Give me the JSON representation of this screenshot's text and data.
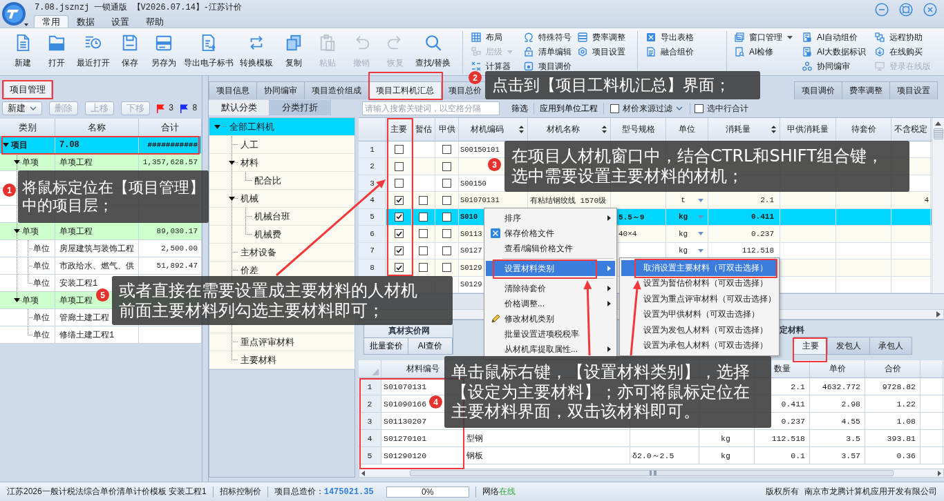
{
  "window": {
    "title": "7.08.jsznzj 一锁通版 【V2026.07.14】-江苏计价"
  },
  "menu_tabs": [
    {
      "label": "常用",
      "selected": true
    },
    {
      "label": "数据",
      "selected": false
    },
    {
      "label": "设置",
      "selected": false
    },
    {
      "label": "帮助",
      "selected": false
    }
  ],
  "ribbon": {
    "large_buttons": [
      {
        "label": "新建",
        "disabled": false
      },
      {
        "label": "打开",
        "disabled": false
      },
      {
        "label": "最近打开",
        "disabled": false
      },
      {
        "label": "保存",
        "disabled": false
      },
      {
        "label": "另存为",
        "disabled": false
      },
      {
        "label": "导出电子标书",
        "disabled": false
      },
      {
        "label": "转换模板",
        "disabled": false
      },
      {
        "label": "复制",
        "disabled": false
      },
      {
        "label": "粘贴",
        "disabled": true
      },
      {
        "label": "撤销",
        "disabled": true
      },
      {
        "label": "恢复",
        "disabled": true
      },
      {
        "label": "查找/替换",
        "disabled": false
      }
    ],
    "groups": [
      {
        "columns": [
          [
            {
              "label": "布局",
              "disabled": false
            },
            {
              "label": "层级",
              "disabled": true,
              "dropdown": true
            },
            {
              "label": "计算器",
              "disabled": false
            }
          ],
          [
            {
              "label": "特殊符号",
              "disabled": false
            },
            {
              "label": "清单编辑",
              "disabled": false
            },
            {
              "label": "项目调价",
              "disabled": false
            }
          ],
          [
            {
              "label": "费率调整",
              "disabled": false
            },
            {
              "label": "项目设置",
              "disabled": false
            }
          ]
        ]
      },
      {
        "columns": [
          [
            {
              "label": "导出表格",
              "disabled": false
            },
            {
              "label": "融合组价",
              "disabled": false
            }
          ]
        ]
      },
      {
        "columns": [
          [
            {
              "label": "窗口管理",
              "disabled": false,
              "dropdown": true
            },
            {
              "label": "AI检修",
              "disabled": false
            }
          ],
          [
            {
              "label": "AI自动组价",
              "disabled": false
            },
            {
              "label": "AI大数据标识",
              "disabled": false
            },
            {
              "label": "协同编审",
              "disabled": false
            }
          ],
          [
            {
              "label": "远程协助",
              "disabled": false
            },
            {
              "label": "在线购买",
              "disabled": false
            },
            {
              "label": "登录在线版",
              "disabled": true
            }
          ]
        ]
      }
    ]
  },
  "project_panel": {
    "tab": {
      "label": "项目管理",
      "selected": true
    },
    "toolbar": [
      {
        "label": "新建",
        "disabled": false,
        "dropdown": true
      },
      {
        "label": "删除",
        "disabled": true
      },
      {
        "label": "上移",
        "disabled": true
      },
      {
        "label": "下移",
        "disabled": true
      }
    ],
    "flags": [
      {
        "color": "#ff1a1a",
        "count": "3"
      },
      {
        "color": "#1a2cff",
        "count": "8"
      }
    ],
    "columns": [
      "类别",
      "名称",
      "合计"
    ],
    "tree": [
      {
        "kind": "project",
        "category": "项目",
        "name": "7.08",
        "total": "###########",
        "selected": true,
        "expanded": true,
        "children": [
          {
            "kind": "section",
            "category": "单项",
            "name": "单项工程",
            "total": "1,357,628.57",
            "selected": false,
            "expanded": true,
            "children": [
              {
                "kind": "unit",
                "selected": false
              },
              {
                "kind": "unit",
                "selected": false
              },
              {
                "kind": "unit",
                "selected": false
              }
            ]
          },
          {
            "kind": "section",
            "category": "单项",
            "name": "单项工程",
            "total": "89,030.17",
            "selected": false,
            "expanded": true,
            "children": [
              {
                "kind": "unit",
                "category": "单位",
                "name": "房屋建筑与装饰工程",
                "total": "2,500.00",
                "selected": false
              },
              {
                "kind": "unit",
                "category": "单位",
                "name": "市政给水、燃气、供",
                "total": "51,892.47",
                "selected": false
              },
              {
                "kind": "unit",
                "category": "单位",
                "name": "安装工程1",
                "selected": false
              }
            ]
          },
          {
            "kind": "section",
            "category": "单项",
            "name": "单项工程",
            "selected": false,
            "expanded": true,
            "children": [
              {
                "kind": "unit",
                "category": "单位",
                "name": "管廊土建工程",
                "selected": false
              },
              {
                "kind": "unit",
                "category": "单位",
                "name": "修缮土建工程1",
                "selected": false
              }
            ]
          }
        ]
      }
    ]
  },
  "main_tabs": [
    {
      "label": "项目信息",
      "selected": false
    },
    {
      "label": "协同编审",
      "selected": false
    },
    {
      "label": "项目造价组成",
      "selected": false
    },
    {
      "label": "项目工料机汇总",
      "selected": true
    },
    {
      "label": "项目总价",
      "selected": false
    }
  ],
  "main_actions": [
    "项目调价",
    "费率调整",
    "项目设置"
  ],
  "category_panel": {
    "tabs": [
      {
        "label": "默认分类",
        "selected": true
      },
      {
        "label": "分类打折",
        "selected": false
      }
    ],
    "tree": [
      {
        "label": "全部工料机",
        "selected": true,
        "expanded": true,
        "children": [
          {
            "label": "人工",
            "selected": false
          },
          {
            "label": "材料",
            "selected": false,
            "expanded": true,
            "children": [
              {
                "label": "配合比",
                "selected": false
              }
            ]
          },
          {
            "label": "机械",
            "selected": false,
            "expanded": true,
            "children": [
              {
                "label": "机械台班",
                "selected": false
              },
              {
                "label": "机械费",
                "selected": false
              }
            ]
          },
          {
            "label": "主材设备",
            "selected": false
          },
          {
            "label": "价差",
            "selected": false
          },
          {
            "selected": false
          },
          {
            "selected": false
          },
          {
            "selected": false
          },
          {
            "label": "重点评审材料",
            "selected": false
          },
          {
            "label": "主要材料",
            "selected": false
          }
        ]
      }
    ]
  },
  "materials_grid": {
    "search": {
      "placeholder": "请输入搜索关键词，以空格分隔"
    },
    "buttons": [
      "筛选",
      "应用到单位工程"
    ],
    "options": [
      {
        "label": "材价来源过滤",
        "checked": false,
        "dropdown": true
      },
      {
        "label": "选中行合计",
        "checked": false
      }
    ],
    "columns": [
      {
        "label": "主要"
      },
      {
        "label": "暂估"
      },
      {
        "label": "甲供"
      },
      {
        "label": "材机编码",
        "sortable": true
      },
      {
        "label": "材机名称",
        "sortable": true
      },
      {
        "label": "型号规格"
      },
      {
        "label": "单位"
      },
      {
        "label": "消耗量",
        "sortable": true
      },
      {
        "label": "甲供消耗量"
      },
      {
        "label": "待套价"
      },
      {
        "label": "不含税定"
      }
    ],
    "rows": [
      {
        "number": "1",
        "main": false,
        "owner_supplied": false,
        "code": "S00150101",
        "selected": false
      },
      {
        "number": "2",
        "main": false,
        "owner_supplied": false,
        "selected": false
      },
      {
        "number": "3",
        "main": false,
        "owner_supplied": false,
        "code": "S00150",
        "selected": false
      },
      {
        "number": "4",
        "main": true,
        "provisional": false,
        "owner_supplied": false,
        "code": "S01070131",
        "name": "有粘结钢绞线 1570级",
        "unit": "t",
        "quantity": "2.1",
        "excl_tax": "4",
        "selected": false
      },
      {
        "number": "5",
        "main": true,
        "provisional": false,
        "owner_supplied": false,
        "code": "S010",
        "spec": "5.5～9",
        "unit": "kg",
        "quantity": "0.411",
        "selected": true
      },
      {
        "number": "6",
        "main": true,
        "provisional": false,
        "owner_supplied": false,
        "code": "S0113",
        "spec": "40×4",
        "unit": "kg",
        "quantity": "0.237",
        "selected": false
      },
      {
        "number": "7",
        "main": true,
        "provisional": false,
        "owner_supplied": false,
        "code": "S0127",
        "unit": "kg",
        "quantity": "112.518",
        "selected": false
      },
      {
        "number": "8",
        "main": true,
        "provisional": false,
        "owner_supplied": false,
        "code": "S0129",
        "selected": false
      },
      {
        "code": "S0129",
        "selected": false
      }
    ]
  },
  "bottom_panel": {
    "left_group": {
      "title": "真材实价网",
      "buttons": [
        "批量套价",
        "AI查价"
      ]
    },
    "right_group": {
      "title": "定材料",
      "tabs": [
        {
          "label": "主要",
          "selected": true
        },
        {
          "label": "发包人",
          "selected": false
        },
        {
          "label": "承包人",
          "selected": false
        }
      ]
    },
    "columns": [
      "材料编号",
      null,
      null,
      null,
      "数量",
      "单价",
      "合价"
    ],
    "rows": [
      {
        "number": "1",
        "code": "S01070131",
        "quantity": "2.1",
        "price": "4632.772",
        "amount": "9728.82"
      },
      {
        "number": "2",
        "code": "S01090166",
        "quantity": "0.411",
        "price": "2.98",
        "amount": "1.22"
      },
      {
        "number": "3",
        "code": "S01130207",
        "quantity": "0.237",
        "price": "4.55",
        "amount": "1.08"
      },
      {
        "number": "4",
        "code": "S01270101",
        "name": "型钢",
        "unit": "kg",
        "quantity": "112.518",
        "price": "3.5",
        "amount": "393.81"
      },
      {
        "number": "5",
        "code": "S01290120",
        "name": "钢板",
        "spec": "δ2.0～2.5",
        "unit": "kg",
        "quantity": "0.1",
        "price": "3.57",
        "amount": "0.36"
      }
    ]
  },
  "context_menu": [
    {
      "label": "排序",
      "submenu": true,
      "selected": false
    },
    {
      "label": "保存价格文件",
      "selected": false
    },
    {
      "label": "查看/编辑价格文件",
      "selected": false
    },
    {
      "label": "设置材料类别",
      "submenu": true,
      "divider_before": true,
      "selected": true
    },
    {
      "label": "清除待套价",
      "submenu": true,
      "divider_before": true,
      "selected": false
    },
    {
      "label": "价格调整...",
      "submenu": true,
      "selected": false
    },
    {
      "label": "修改材机类别",
      "selected": false
    },
    {
      "label": "批量设置进项税税率",
      "selected": false
    },
    {
      "label": "从材机库提取属性...",
      "submenu": true,
      "selected": false
    }
  ],
  "submenu": [
    {
      "label": "取消设置主要材料（可双击选择）",
      "selected": true
    },
    {
      "label": "设置为暂估价材料（可双击选择）",
      "selected": false
    },
    {
      "label": "设置为重点评审材料（可双击选择）",
      "selected": false
    },
    {
      "label": "设置为甲供材料（可双击选择）",
      "selected": false
    },
    {
      "label": "设置为发包人材料（可双击选择）",
      "selected": false
    },
    {
      "label": "设置为承包人材料（可双击选择）",
      "selected": false
    }
  ],
  "annotations": [
    {
      "number": "1",
      "text": "将鼠标定位在【项目管理】中的项目层；"
    },
    {
      "number": "2",
      "text": "点击到【项目工料机汇总】界面；"
    },
    {
      "number": "3",
      "text": "在项目人材机窗口中，结合CTRL和SHIFT组合键，选中需要设置主要材料的材机；"
    },
    {
      "number": "4",
      "text": "单击鼠标右键，【设置材料类别】，选择【设定为主要材料】；亦可将鼠标定位在主要材料界面，双击该材料即可。"
    },
    {
      "number": "5",
      "text": "或者直接在需要设置成主要材料的人材机前面主要材料列勾选主要材料即可；"
    }
  ],
  "status_bar": {
    "template": "江苏2026一般计税法综合单价清单计价模板 安装工程1",
    "mode": "招标控制价",
    "total_label": "项目总造价：",
    "total_value": "1475021.35",
    "progress": {
      "level": 0,
      "text": "0%"
    },
    "network": {
      "label": "网络",
      "status": "在线",
      "online": true
    },
    "copyright": "版权所有",
    "company": "南京市龙腾计算机应用开发有限公司"
  }
}
